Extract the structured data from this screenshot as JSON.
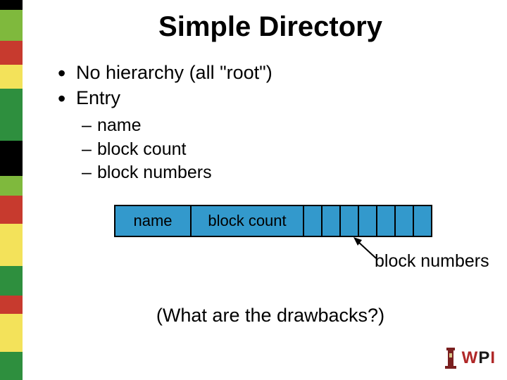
{
  "title": "Simple Directory",
  "bullets": [
    "No hierarchy (all \"root\")",
    "Entry"
  ],
  "sub_bullets": [
    "name",
    "block count",
    "block numbers"
  ],
  "diagram": {
    "name_label": "name",
    "block_count_label": "block count",
    "block_numbers_label": "block numbers"
  },
  "question": "(What are the drawbacks?)",
  "logo": {
    "w": "W",
    "p": "P",
    "i": "I"
  },
  "sidebar_colors": [
    {
      "c": "#000000",
      "h": 14
    },
    {
      "c": "#7fb93d",
      "h": 44
    },
    {
      "c": "#c73a2e",
      "h": 34
    },
    {
      "c": "#f3e25a",
      "h": 34
    },
    {
      "c": "#2e8f3e",
      "h": 74
    },
    {
      "c": "#000000",
      "h": 50
    },
    {
      "c": "#7fb93d",
      "h": 28
    },
    {
      "c": "#c73a2e",
      "h": 40
    },
    {
      "c": "#f3e25a",
      "h": 60
    },
    {
      "c": "#2e8f3e",
      "h": 42
    },
    {
      "c": "#c73a2e",
      "h": 26
    },
    {
      "c": "#f3e25a",
      "h": 54
    },
    {
      "c": "#2e8f3e",
      "h": 40
    }
  ]
}
